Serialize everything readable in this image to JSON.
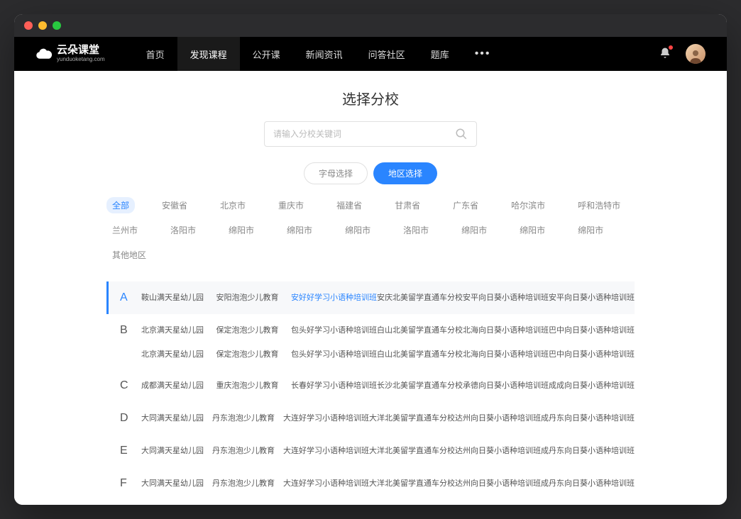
{
  "logo": {
    "main": "云朵课堂",
    "sub": "yunduoketang.com"
  },
  "nav": {
    "items": [
      "首页",
      "发现课程",
      "公开课",
      "新闻资讯",
      "问答社区",
      "题库"
    ],
    "active_index": 1
  },
  "page_title": "选择分校",
  "search": {
    "placeholder": "请输入分校关键词"
  },
  "tabs": {
    "inactive": "字母选择",
    "active": "地区选择"
  },
  "regions": [
    "全部",
    "安徽省",
    "北京市",
    "重庆市",
    "福建省",
    "甘肃省",
    "广东省",
    "哈尔滨市",
    "呼和浩特市",
    "兰州市",
    "洛阳市",
    "绵阳市",
    "绵阳市",
    "绵阳市",
    "洛阳市",
    "绵阳市",
    "绵阳市",
    "绵阳市",
    "其他地区"
  ],
  "region_active_index": 0,
  "letter_groups": [
    {
      "letter": "A",
      "highlighted": true,
      "rows": [
        [
          {
            "name": "鞍山满天星幼儿园"
          },
          {
            "name": "安阳泡泡少儿教育"
          },
          {
            "name": "安好好学习小语种培训班",
            "highlighted": true
          },
          {
            "name": "安庆北美留学直通车分校"
          },
          {
            "name": "安平向日葵小语种培训班"
          },
          {
            "name": "安平向日葵小语种培训班"
          }
        ]
      ]
    },
    {
      "letter": "B",
      "rows": [
        [
          {
            "name": "北京满天星幼儿园"
          },
          {
            "name": "保定泡泡少儿教育"
          },
          {
            "name": "包头好学习小语种培训班"
          },
          {
            "name": "白山北美留学直通车分校"
          },
          {
            "name": "北海向日葵小语种培训班"
          },
          {
            "name": "巴中向日葵小语种培训班"
          }
        ],
        [
          {
            "name": "北京满天星幼儿园"
          },
          {
            "name": "保定泡泡少儿教育"
          },
          {
            "name": "包头好学习小语种培训班"
          },
          {
            "name": "白山北美留学直通车分校"
          },
          {
            "name": "北海向日葵小语种培训班"
          },
          {
            "name": "巴中向日葵小语种培训班"
          }
        ]
      ]
    },
    {
      "letter": "C",
      "rows": [
        [
          {
            "name": "成都满天星幼儿园"
          },
          {
            "name": "重庆泡泡少儿教育"
          },
          {
            "name": "长春好学习小语种培训班"
          },
          {
            "name": "长沙北美留学直通车分校"
          },
          {
            "name": "承德向日葵小语种培训班"
          },
          {
            "name": "成成向日葵小语种培训班"
          }
        ]
      ]
    },
    {
      "letter": "D",
      "rows": [
        [
          {
            "name": "大同满天星幼儿园"
          },
          {
            "name": "丹东泡泡少儿教育"
          },
          {
            "name": "大连好学习小语种培训班"
          },
          {
            "name": "大洋北美留学直通车分校"
          },
          {
            "name": "达州向日葵小语种培训班"
          },
          {
            "name": "成丹东向日葵小语种培训班"
          }
        ]
      ]
    },
    {
      "letter": "E",
      "rows": [
        [
          {
            "name": "大同满天星幼儿园"
          },
          {
            "name": "丹东泡泡少儿教育"
          },
          {
            "name": "大连好学习小语种培训班"
          },
          {
            "name": "大洋北美留学直通车分校"
          },
          {
            "name": "达州向日葵小语种培训班"
          },
          {
            "name": "成丹东向日葵小语种培训班"
          }
        ]
      ]
    },
    {
      "letter": "F",
      "rows": [
        [
          {
            "name": "大同满天星幼儿园"
          },
          {
            "name": "丹东泡泡少儿教育"
          },
          {
            "name": "大连好学习小语种培训班"
          },
          {
            "name": "大洋北美留学直通车分校"
          },
          {
            "name": "达州向日葵小语种培训班"
          },
          {
            "name": "成丹东向日葵小语种培训班"
          }
        ]
      ]
    }
  ]
}
